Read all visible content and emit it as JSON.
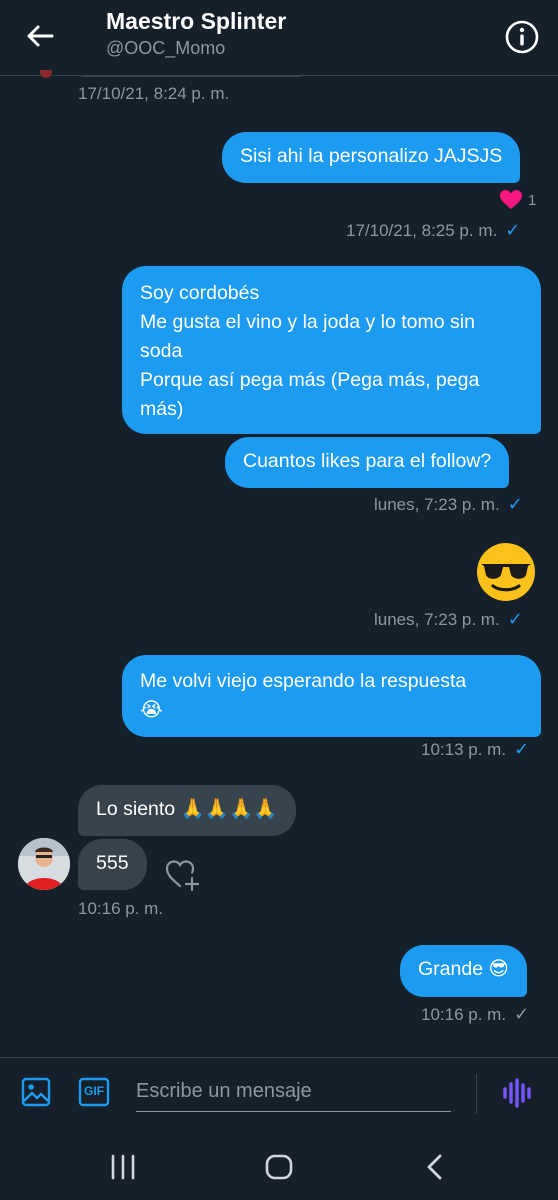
{
  "header": {
    "title": "Maestro Splinter",
    "handle": "@OOC_Momo"
  },
  "timestamps": {
    "t1": "17/10/21, 8:24 p. m.",
    "t2": "17/10/21, 8:25 p. m.",
    "t3": "lunes, 7:23 p. m.",
    "t4": "lunes, 7:23 p. m.",
    "t5": "10:13 p. m.",
    "t6": "10:16 p. m.",
    "t7": "10:16 p. m."
  },
  "messages": {
    "m1": "Sisi ahi la personalizo JAJSJS",
    "m2_lines": [
      "Soy cordobés",
      "Me gusta el vino y la joda y lo tomo sin",
      "soda",
      "Porque así pega más (Pega más, pega",
      "más)"
    ],
    "m3": "Cuantos likes para el follow?",
    "m4": "😎",
    "m5_line1": "Me volvi viejo esperando la respuesta",
    "m5_line2": "😭",
    "m6": "Lo siento 🙏🙏🙏🙏",
    "m7": "555",
    "m8": "Grande 😎"
  },
  "reaction": {
    "count": "1"
  },
  "composer": {
    "placeholder": "Escribe un mensaje",
    "gif_label": "GIF"
  },
  "colors": {
    "background": "#15202b",
    "outgoing_bubble": "#1d9bf0",
    "incoming_bubble": "#38444d",
    "muted_text": "#8899a6",
    "heart": "#f91880",
    "voice": "#7856ff"
  }
}
